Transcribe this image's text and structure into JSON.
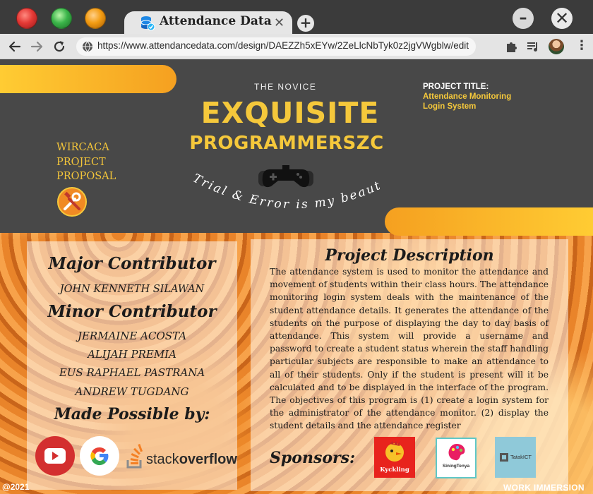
{
  "browser": {
    "tab_title": "Attendance Data",
    "url": "https://www.attendancedata.com/design/DAEZZh5xEYw/2ZeLlcNbTyk0z2jgVWgblw/edit",
    "icons": [
      "close-dot",
      "maximize-dot",
      "minimize-dot",
      "database-icon",
      "close-icon",
      "plus-icon",
      "minimize-icon",
      "close-window-icon",
      "back-arrow-icon",
      "forward-arrow-icon",
      "reload-icon",
      "globe-icon",
      "puzzle-icon",
      "playlist-icon",
      "avatar",
      "more-icon"
    ]
  },
  "hero": {
    "proposal_lines": [
      "WIRCACA",
      "PROJECT",
      "PROPOSAL"
    ],
    "kicker": "THE NOVICE",
    "title_line1": "EXQUISITE",
    "title_line2": "PROGRAMMERSZC",
    "tagline": "Trial & Error is my beauty",
    "project_label": "PROJECT TITLE:",
    "project_name_lines": [
      "Attendance Monitoring",
      "Login System"
    ],
    "accent_color": "#f5c83b",
    "icons": [
      "tools-icon",
      "gamepad-icon"
    ]
  },
  "contributors": {
    "major_heading": "Major Contributor",
    "major_names": [
      "JOHN KENNETH SILAWAN"
    ],
    "minor_heading": "Minor Contributor",
    "minor_names": [
      "JERMAINE ACOSTA",
      "ALIJAH PREMIA",
      "EUS RAPHAEL PASTRANA",
      "ANDREW TUGDANG"
    ],
    "made_possible_heading": "Made Possible by:",
    "stackoverflow_prefix": "stack",
    "stackoverflow_suffix": "overflow",
    "icons": [
      "youtube-logo",
      "google-logo",
      "stackoverflow-logo"
    ]
  },
  "description": {
    "heading": "Project Description",
    "body": "The attendance system is used to monitor the attendance and movement of students within their class hours. The attendance monitoring login system deals with the maintenance of the student attendance details. It generates the attendance of the students on the purpose of displaying the day to day basis of attendance. This system will provide a username and password to create a student status wherein the staff handling particular subjects are responsible to make an attendance to all of their students. Only if the student is present will it be calculated and to be displayed in the interface of the program. The objectives of this program is (1) create a login system for the administrator of the attendance monitor. (2) display the student details and the attendance register",
    "sponsors_heading": "Sponsors:",
    "sponsors": [
      "Kyckling",
      "SiningTenya",
      "TatakICT"
    ]
  },
  "footer": {
    "left": "@2021",
    "right": "WORK IMMERSION"
  }
}
